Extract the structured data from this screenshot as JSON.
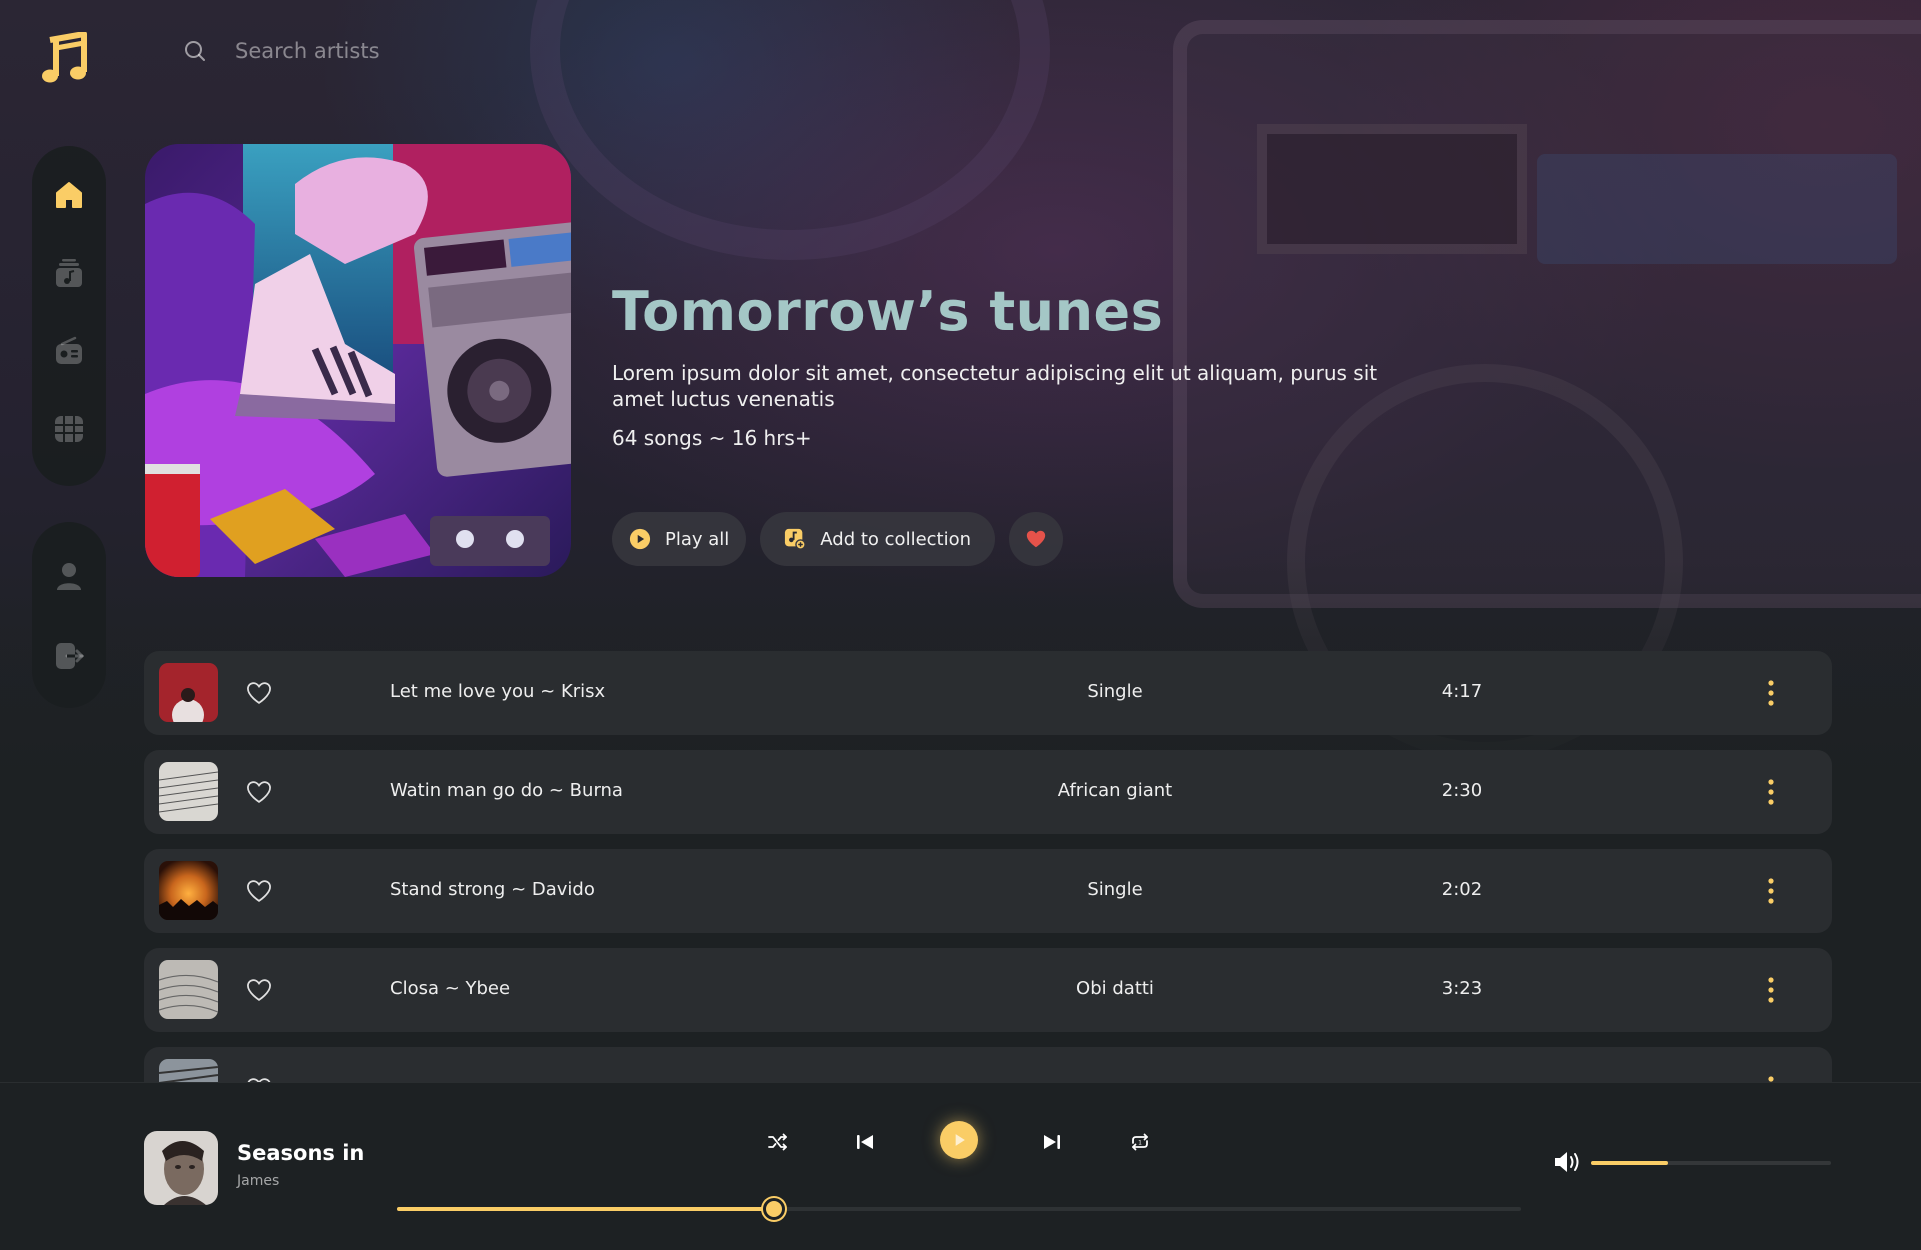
{
  "app": {
    "accent_color": "#facd66",
    "title_color": "#a4c7c6"
  },
  "search": {
    "placeholder": "Search artists"
  },
  "sidebar": {
    "main_items": [
      {
        "name": "home",
        "icon": "home-icon",
        "active": true
      },
      {
        "name": "library",
        "icon": "music-library-icon",
        "active": false
      },
      {
        "name": "radio",
        "icon": "radio-icon",
        "active": false
      },
      {
        "name": "videos",
        "icon": "video-grid-icon",
        "active": false
      }
    ],
    "bottom_items": [
      {
        "name": "profile",
        "icon": "profile-icon"
      },
      {
        "name": "logout",
        "icon": "logout-icon"
      }
    ]
  },
  "hero": {
    "title": "Tomorrow’s tunes",
    "description": "Lorem ipsum dolor sit amet, consectetur adipiscing elit ut aliquam, purus sit amet luctus venenatis",
    "meta": "64 songs ~ 16 hrs+",
    "play_all_label": "Play all",
    "add_collection_label": "Add to collection"
  },
  "tracks": [
    {
      "title": "Let me love you ~ Krisx",
      "album": "Single",
      "duration": "4:17",
      "thumb_color": "#a4242c"
    },
    {
      "title": "Watin man go do ~ Burna",
      "album": "African giant",
      "duration": "2:30",
      "thumb_color": "#d9d7d2"
    },
    {
      "title": "Stand strong ~ Davido",
      "album": "Single",
      "duration": "2:02",
      "thumb_color": "#c9661d"
    },
    {
      "title": "Closa ~ Ybee",
      "album": "Obi datti",
      "duration": "3:23",
      "thumb_color": "#bdbab5"
    },
    {
      "title": "",
      "album": "",
      "duration": "",
      "thumb_color": "#8c949c"
    }
  ],
  "player": {
    "song_title": "Seasons in",
    "artist": "James",
    "progress": 0.334,
    "volume": 0.32
  }
}
